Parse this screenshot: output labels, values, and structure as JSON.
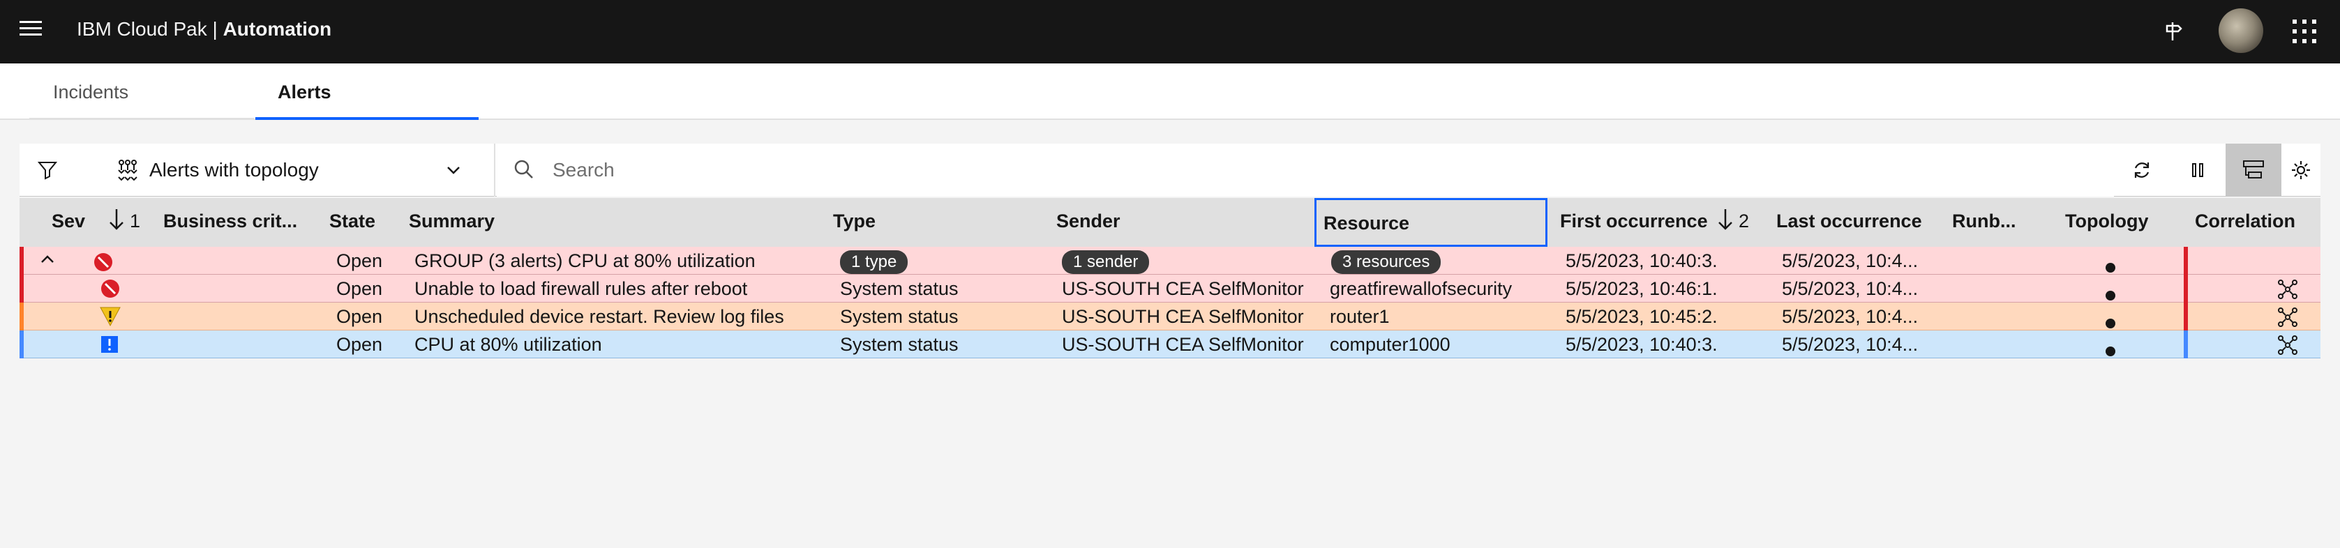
{
  "header": {
    "brand_prefix": "IBM Cloud Pak | ",
    "brand_product": "Automation"
  },
  "tabs": [
    {
      "label": "Incidents",
      "active": false
    },
    {
      "label": "Alerts",
      "active": true
    }
  ],
  "toolbar": {
    "view_label": "Alerts with topology",
    "search_placeholder": "Search"
  },
  "columns": {
    "sev": "Sev",
    "sort1": "1",
    "business": "Business crit...",
    "state": "State",
    "summary": "Summary",
    "type": "Type",
    "sender": "Sender",
    "resource": "Resource",
    "first": "First occurrence",
    "sort2": "2",
    "last": "Last occurrence",
    "runbook": "Runb...",
    "topology": "Topology",
    "correlation": "Correlation"
  },
  "rows": [
    {
      "severity": "critical",
      "state": "Open",
      "summary": "GROUP (3 alerts) CPU at 80% utilization",
      "type": "1 type",
      "sender": "1 sender",
      "resource": "3 resources",
      "first": "5/5/2023, 10:40:3...",
      "last": "5/5/2023, 10:4..."
    },
    {
      "severity": "critical",
      "state": "Open",
      "summary": "Unable to load firewall rules after reboot",
      "type": "System status",
      "sender": "US-SOUTH CEA SelfMonitor",
      "resource": "greatfirewallofsecurity",
      "first": "5/5/2023, 10:46:1...",
      "last": "5/5/2023, 10:4..."
    },
    {
      "severity": "major",
      "state": "Open",
      "summary": "Unscheduled device restart. Review log files",
      "type": "System status",
      "sender": "US-SOUTH CEA SelfMonitor",
      "resource": "router1",
      "first": "5/5/2023, 10:45:2...",
      "last": "5/5/2023, 10:4..."
    },
    {
      "severity": "warning",
      "state": "Open",
      "summary": "CPU at 80% utilization",
      "type": "System status",
      "sender": "US-SOUTH CEA SelfMonitor",
      "resource": "computer1000",
      "first": "5/5/2023, 10:40:3...",
      "last": "5/5/2023, 10:4..."
    }
  ],
  "colors": {
    "critical": "#da1e28",
    "major": "#f1c21b",
    "warning": "#0f62fe",
    "accent": "#0f62fe"
  }
}
